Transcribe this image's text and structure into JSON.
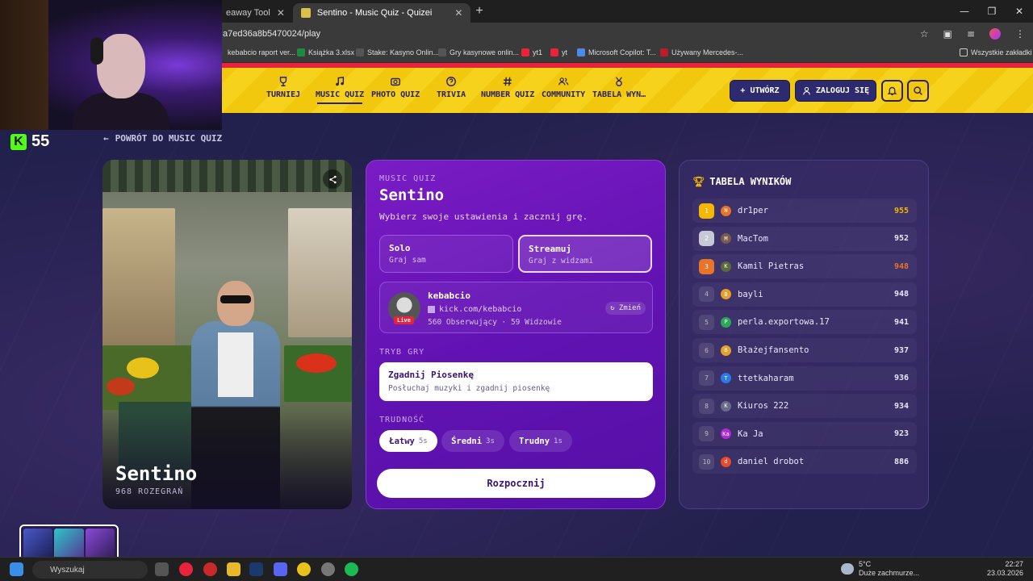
{
  "browser": {
    "tabs": [
      {
        "label": "eaway Tool",
        "active": false
      },
      {
        "label": "Sentino - Music Quiz - Quizei",
        "active": true
      }
    ],
    "url": "a7ed36a8b5470024/play",
    "bookmarks": [
      "kebabcio raport ver...",
      "Książka 3.xlsx",
      "Stake: Kasyno Onlin...",
      "Gry kasynowe onlin...",
      "yt1",
      "yt",
      "Microsoft Copilot: T...",
      "Używany Mercedes-..."
    ],
    "all_bookmarks": "Wszystkie zakładki"
  },
  "nav": {
    "items": [
      {
        "label": "TURNIEJ",
        "icon": "trophy-icon"
      },
      {
        "label": "MUSIC QUIZ",
        "icon": "music-note-icon",
        "active": true
      },
      {
        "label": "PHOTO QUIZ",
        "icon": "camera-icon"
      },
      {
        "label": "TRIVIA",
        "icon": "question-icon"
      },
      {
        "label": "NUMBER QUIZ",
        "icon": "hash-icon"
      },
      {
        "label": "COMMUNITY",
        "icon": "users-icon"
      },
      {
        "label": "TABELA WYN…",
        "icon": "medal-icon"
      }
    ],
    "create": "+ UTWÓRZ",
    "login": "ZALOGUJ SIĘ"
  },
  "back_link": "POWRÓT DO MUSIC QUIZ",
  "hero": {
    "title": "Sentino",
    "subtitle": "968 ROZEGRAŃ"
  },
  "quiz": {
    "category": "MUSIC QUIZ",
    "title": "Sentino",
    "description": "Wybierz swoje ustawienia i zacznij grę.",
    "modes": [
      {
        "title": "Solo",
        "sub": "Graj sam",
        "selected": false
      },
      {
        "title": "Streamuj",
        "sub": "Graj z widzami",
        "selected": true
      }
    ],
    "streamer": {
      "name": "kebabcio",
      "url": "kick.com/kebabcio",
      "stats": "560 Obserwujący · 59 Widzowie",
      "live": "Live",
      "change": "Zmień"
    },
    "game_mode_label": "TRYB GRY",
    "game_mode": {
      "title": "Zgadnij Piosenkę",
      "sub": "Posłuchaj muzyki i zgadnij piosenkę"
    },
    "difficulty_label": "TRUDNOŚĆ",
    "difficulties": [
      {
        "label": "Łatwy",
        "time": "5s",
        "selected": true
      },
      {
        "label": "Średni",
        "time": "3s",
        "selected": false
      },
      {
        "label": "Trudny",
        "time": "1s",
        "selected": false
      }
    ],
    "start": "Rozpocznij"
  },
  "leaderboard": {
    "title": "TABELA WYNIKÓW",
    "rows": [
      {
        "rank": "1",
        "initial": "N",
        "color": "#e8742a",
        "name": "dr1per",
        "score": "955",
        "highlight": "#f5b700"
      },
      {
        "rank": "2",
        "initial": "M",
        "color": "#7a5a4a",
        "name": "MacTom",
        "score": "952",
        "highlight": "#c7c9d4"
      },
      {
        "rank": "3",
        "initial": "K",
        "color": "#5a6a3a",
        "name": "Kamil Pietras",
        "score": "948",
        "highlight": "#e8742a"
      },
      {
        "rank": "4",
        "initial": "B",
        "color": "#e8a02a",
        "name": "bayli",
        "score": "948"
      },
      {
        "rank": "5",
        "initial": "P",
        "color": "#2aa85a",
        "name": "perla.exportowa.17",
        "score": "941"
      },
      {
        "rank": "6",
        "initial": "B",
        "color": "#e8a02a",
        "name": "Błażejfansento",
        "score": "937"
      },
      {
        "rank": "7",
        "initial": "T",
        "color": "#2a7ae8",
        "name": "ttetkaharam",
        "score": "936"
      },
      {
        "rank": "8",
        "initial": "K",
        "color": "#6a6a8a",
        "name": "Kiuros 222",
        "score": "934"
      },
      {
        "rank": "9",
        "initial": "Ka",
        "color": "#b02ad8",
        "name": "Ka Ja",
        "score": "923"
      },
      {
        "rank": "10",
        "initial": "d",
        "color": "#e84a2a",
        "name": "daniel drobot",
        "score": "886"
      }
    ]
  },
  "overlay": {
    "kick_count": "55"
  },
  "taskbar": {
    "search": "Wyszukaj",
    "weather_temp": "5°C",
    "weather_desc": "Duże zachmurze...",
    "time": "22:27",
    "date": "23.03.2026"
  }
}
